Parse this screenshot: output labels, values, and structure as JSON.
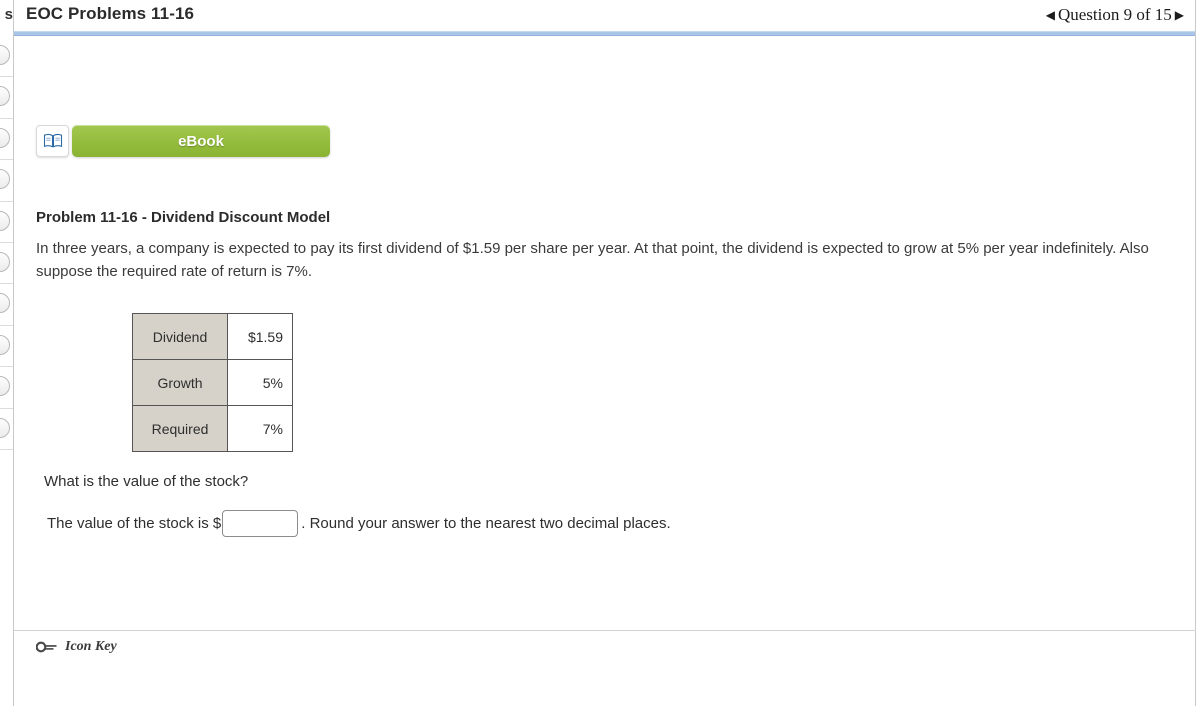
{
  "header": {
    "title": "EOC Problems 11-16",
    "nav": {
      "prev_icon": "◀",
      "label": "Question 9 of 15",
      "next_icon": "▶"
    }
  },
  "left_rail": {
    "top_letter": "s",
    "bubble_count": 10
  },
  "toolbar": {
    "ebook_label": "eBook",
    "ebook_icon": "book-icon"
  },
  "problem": {
    "title": "Problem 11-16 - Dividend Discount Model",
    "body": "In three years, a company is expected to pay its first dividend of $1.59 per share per year. At that point, the dividend is expected to grow at 5% per year indefinitely. Also suppose the required rate of return is 7%."
  },
  "table": {
    "rows": [
      {
        "label": "Dividend",
        "value": "$1.59"
      },
      {
        "label": "Growth",
        "value": "5%"
      },
      {
        "label": "Required",
        "value": "7%"
      }
    ]
  },
  "question": {
    "prompt": "What is the value of the stock?",
    "answer_prefix": "The value of the stock is $",
    "answer_value": "",
    "answer_placeholder": "",
    "answer_suffix": ". Round your answer to the nearest two decimal places."
  },
  "footer": {
    "icon_key_label": "Icon Key",
    "icon_key_icon": "key-icon"
  },
  "colors": {
    "accent_blue": "#a9c6e8",
    "ebook_green": "#95bd3e",
    "table_label_bg": "#d6d2c9"
  }
}
